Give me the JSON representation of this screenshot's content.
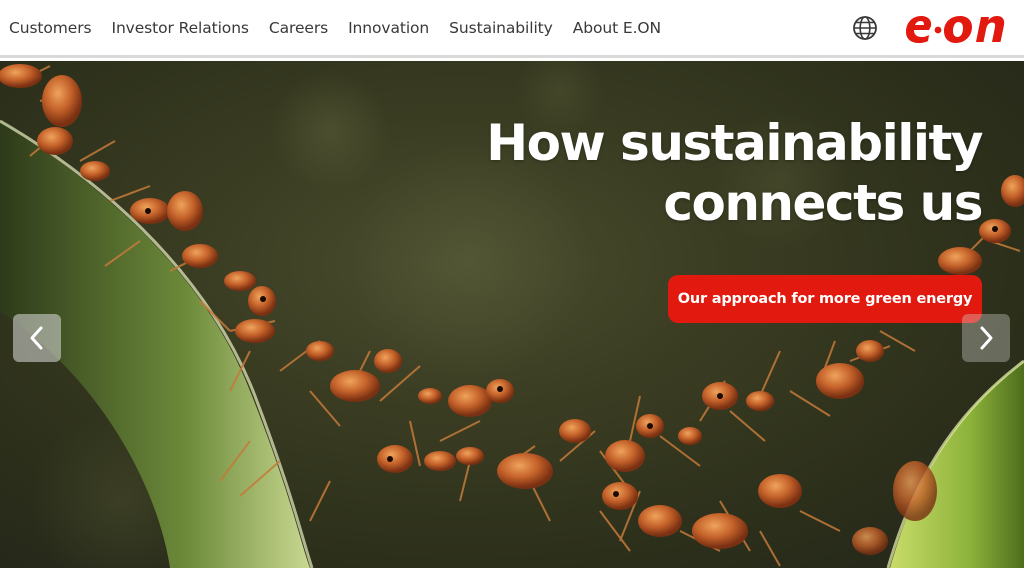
{
  "nav": {
    "items": [
      {
        "label": "Customers"
      },
      {
        "label": "Investor Relations"
      },
      {
        "label": "Careers"
      },
      {
        "label": "Innovation"
      },
      {
        "label": "Sustainability"
      },
      {
        "label": "About E.ON"
      }
    ]
  },
  "header": {
    "globe_icon": "globe-icon",
    "logo_text": "e·on",
    "brand_color": "#e2190f"
  },
  "hero": {
    "title": "How sustainability connects us",
    "cta_label": "Our approach for more green energy",
    "prev_icon": "chevron-left-icon",
    "next_icon": "chevron-right-icon"
  }
}
